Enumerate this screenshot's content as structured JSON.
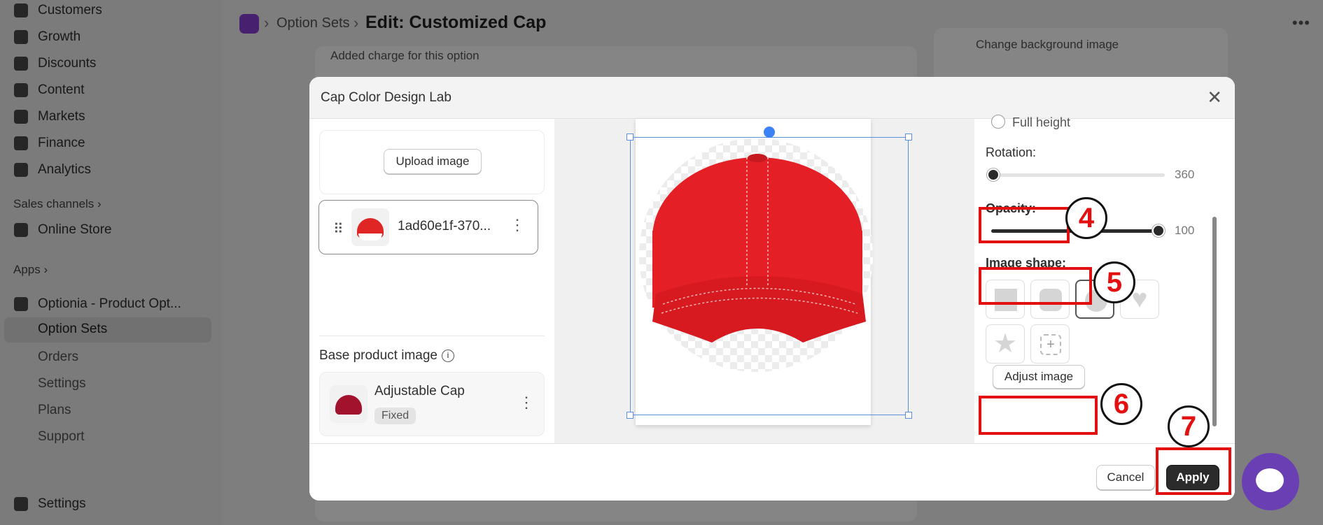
{
  "sidebar": {
    "items": [
      {
        "label": "Customers"
      },
      {
        "label": "Growth"
      },
      {
        "label": "Discounts"
      },
      {
        "label": "Content"
      },
      {
        "label": "Markets"
      },
      {
        "label": "Finance"
      },
      {
        "label": "Analytics"
      }
    ],
    "sales_channels_label": "Sales channels",
    "online_store_label": "Online Store",
    "apps_label": "Apps",
    "app_name": "Optionia - Product Opt...",
    "app_subitems": [
      "Option Sets",
      "Orders",
      "Settings",
      "Plans",
      "Support"
    ],
    "settings_label": "Settings"
  },
  "header": {
    "breadcrumb_link": "Option Sets",
    "title": "Edit: Customized Cap"
  },
  "background": {
    "added_charge_text": "Added charge for this option",
    "change_bg_text": "Change background image"
  },
  "modal": {
    "title": "Cap Color Design Lab",
    "upload_button": "Upload image",
    "layer_name": "1ad60e1f-370...",
    "base_label": "Base product image",
    "base_name": "Adjustable Cap",
    "base_badge": "Fixed",
    "full_height_label": "Full height",
    "rotation_label": "Rotation:",
    "rotation_value": "360",
    "opacity_label": "Opacity:",
    "opacity_value": "100",
    "image_shape_label": "Image shape:",
    "adjust_button": "Adjust image",
    "cancel_button": "Cancel",
    "apply_button": "Apply",
    "rotation_fraction": 0,
    "opacity_fraction": 1
  },
  "annotations": [
    "4",
    "5",
    "6",
    "7"
  ],
  "colors": {
    "accent": "#e21010",
    "selection": "#5b8fe0",
    "cap_red": "#e02525"
  }
}
